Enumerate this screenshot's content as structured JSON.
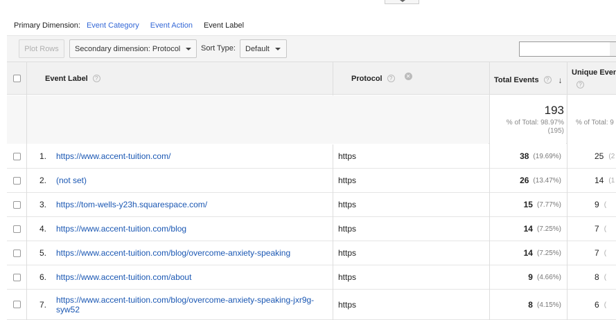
{
  "primary_dimension": {
    "label": "Primary Dimension:",
    "options": [
      "Event Category",
      "Event Action",
      "Event Label"
    ],
    "active": "Event Label"
  },
  "toolbar": {
    "plot_rows": "Plot Rows",
    "secondary_dimension": "Secondary dimension: Protocol",
    "sort_type_label": "Sort Type:",
    "sort_type_value": "Default",
    "search_value": ""
  },
  "columns": {
    "event_label": "Event Label",
    "protocol": "Protocol",
    "total_events": "Total Events",
    "unique_events": "Unique Events",
    "help_glyph": "?",
    "remove_glyph": "✕",
    "sort_glyph": "↓"
  },
  "totals": {
    "total_events": "193",
    "total_events_pct": "% of Total: 98.97%",
    "total_events_abs": "(195)",
    "unique_events_pct": "% of Total: 9"
  },
  "rows": [
    {
      "num": "1.",
      "label": "https://www.accent-tuition.com/",
      "protocol": "https",
      "total": "38",
      "total_pct": "(19.69%)",
      "unique": "25",
      "unique_pct": "(2"
    },
    {
      "num": "2.",
      "label": "(not set)",
      "protocol": "https",
      "total": "26",
      "total_pct": "(13.47%)",
      "unique": "14",
      "unique_pct": "(1"
    },
    {
      "num": "3.",
      "label": "https://tom-wells-y23h.squarespace.com/",
      "protocol": "https",
      "total": "15",
      "total_pct": "(7.77%)",
      "unique": "9",
      "unique_pct": "("
    },
    {
      "num": "4.",
      "label": "https://www.accent-tuition.com/blog",
      "protocol": "https",
      "total": "14",
      "total_pct": "(7.25%)",
      "unique": "7",
      "unique_pct": "("
    },
    {
      "num": "5.",
      "label": "https://www.accent-tuition.com/blog/overcome-anxiety-speaking",
      "protocol": "https",
      "total": "14",
      "total_pct": "(7.25%)",
      "unique": "7",
      "unique_pct": "("
    },
    {
      "num": "6.",
      "label": "https://www.accent-tuition.com/about",
      "protocol": "https",
      "total": "9",
      "total_pct": "(4.66%)",
      "unique": "8",
      "unique_pct": "("
    },
    {
      "num": "7.",
      "label": "https://www.accent-tuition.com/blog/overcome-anxiety-speaking-jxr9g-syw52",
      "protocol": "https",
      "total": "8",
      "total_pct": "(4.15%)",
      "unique": "6",
      "unique_pct": "("
    }
  ]
}
